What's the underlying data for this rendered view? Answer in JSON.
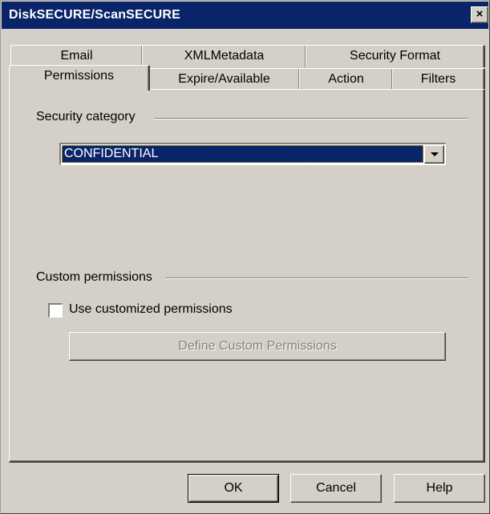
{
  "window": {
    "title": "DiskSECURE/ScanSECURE",
    "close_label": "×"
  },
  "tabs": {
    "row_back": [
      {
        "label": "Email"
      },
      {
        "label": "XMLMetadata"
      },
      {
        "label": "Security Format"
      }
    ],
    "row_front": [
      {
        "label": "Permissions",
        "selected": true
      },
      {
        "label": "Expire/Available"
      },
      {
        "label": "Action"
      },
      {
        "label": "Filters"
      }
    ]
  },
  "security_category": {
    "label": "Security category",
    "selected_value": "CONFIDENTIAL"
  },
  "custom_permissions": {
    "label": "Custom permissions",
    "checkbox_label": "Use customized permissions",
    "checked": false,
    "define_button_label": "Define Custom Permissions"
  },
  "footer": {
    "ok_label": "OK",
    "cancel_label": "Cancel",
    "help_label": "Help"
  },
  "colors": {
    "titlebar": "#0a246a",
    "face": "#d4d0c8",
    "selection": "#0a246a"
  }
}
